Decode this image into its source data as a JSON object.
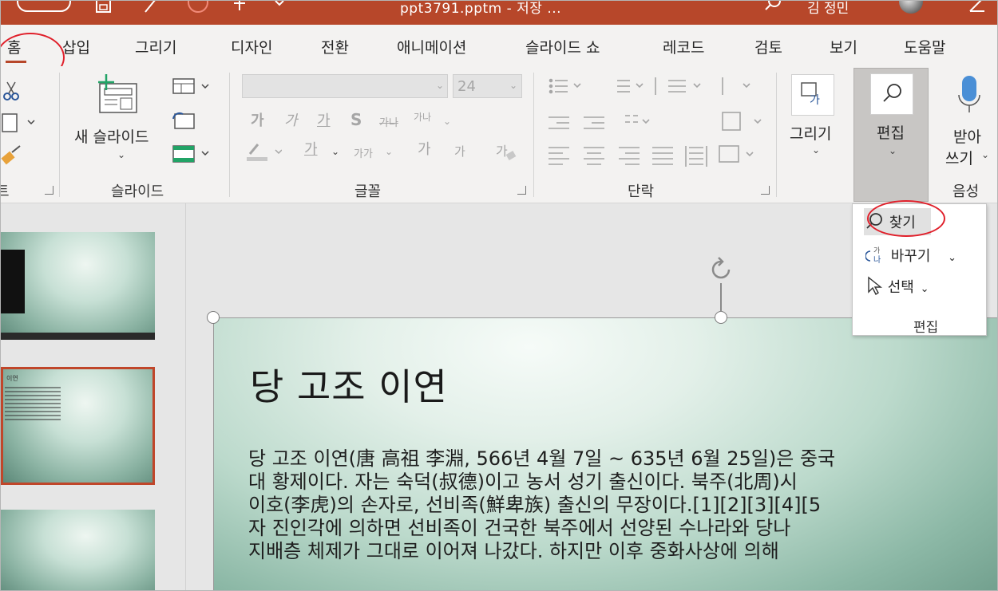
{
  "window": {
    "title": "ppt3791.pptm - 저장 ...",
    "user_name": "김 정민"
  },
  "tabs": [
    {
      "label": "홈"
    },
    {
      "label": "삽입"
    },
    {
      "label": "그리기"
    },
    {
      "label": "디자인"
    },
    {
      "label": "전환"
    },
    {
      "label": "애니메이션"
    },
    {
      "label": "슬라이드 쇼"
    },
    {
      "label": "레코드"
    },
    {
      "label": "검토"
    },
    {
      "label": "보기"
    },
    {
      "label": "도움말"
    }
  ],
  "ribbon": {
    "clipboard_label_partial": "트",
    "slides": {
      "new_slide_label": "새 슬라이드",
      "group_label": "슬라이드"
    },
    "font": {
      "font_name": "",
      "font_size": "24",
      "group_label": "글꼴",
      "bold": "가",
      "italic": "가",
      "underline": "가",
      "shadow": "S",
      "strike": "가나",
      "spacing": "가나",
      "font_color": "가",
      "change_case": "가가",
      "grow": "가",
      "shrink": "가"
    },
    "paragraph": {
      "group_label": "단락"
    },
    "drawing": {
      "label": "그리기"
    },
    "editing": {
      "label": "편집"
    },
    "voice": {
      "label_line1": "받아",
      "label_line2": "쓰기",
      "group_label": "음성"
    }
  },
  "edit_menu": {
    "find": "찾기",
    "replace": "바꾸기",
    "select": "선택",
    "group_label": "편집"
  },
  "slide": {
    "title": "당 고조 이연",
    "body_lines": [
      "당 고조 이연(唐 高祖 李淵, 566년 4월 7일 ~ 635년 6월 25일)은 중국",
      "대 황제이다. 자는 숙덕(叔德)이고 농서 성기 출신이다. 북주(北周)시",
      "이호(李虎)의 손자로, 선비족(鮮卑族) 출신의 무장이다.[1][2][3][4][5",
      "자 진인각에 의하면 선비족이 건국한 북주에서 선양된 수나라와 당나",
      "지배층 체제가 그대로 이어져 나갔다. 하지만 이후 중화사상에 의해"
    ]
  },
  "thumbnail": {
    "title_text": "이연"
  }
}
